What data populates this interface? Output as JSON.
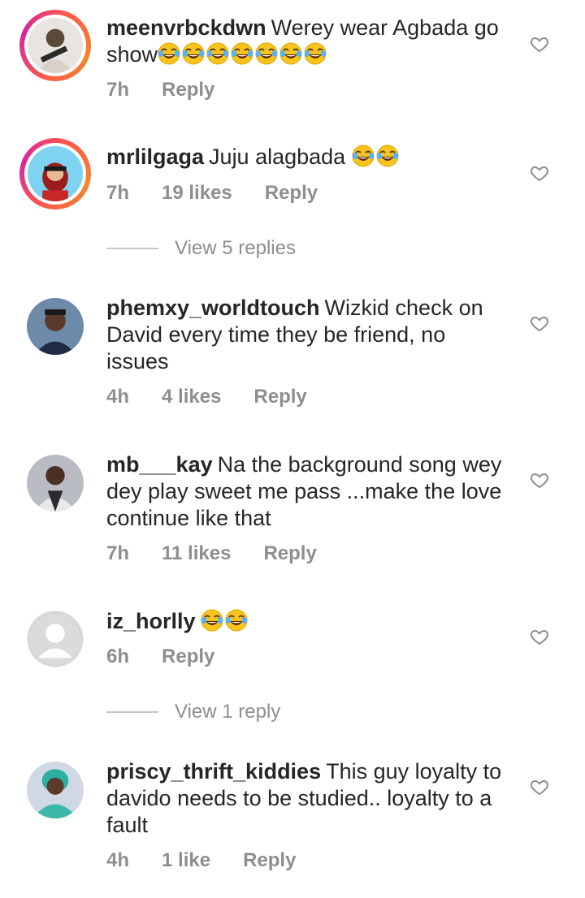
{
  "comments": [
    {
      "username": "meenvrbckdwn",
      "text": "Werey wear Agbada go show",
      "emoji_count": 7,
      "time": "7h",
      "likes": "",
      "reply": "Reply"
    },
    {
      "username": "mrlilgaga",
      "text": "Juju alagbada",
      "emoji_count": 2,
      "time": "7h",
      "likes": "19 likes",
      "reply": "Reply"
    },
    {
      "username": "phemxy_worldtouch",
      "text": "Wizkid check on David every time they be friend, no issues",
      "emoji_count": 0,
      "time": "4h",
      "likes": "4 likes",
      "reply": "Reply"
    },
    {
      "username": "mb___kay",
      "text": "Na the background song wey dey play sweet me pass ...make the love continue like that",
      "emoji_count": 0,
      "time": "7h",
      "likes": "11 likes",
      "reply": "Reply"
    },
    {
      "username": "iz_horlly",
      "text": "",
      "emoji_count": 2,
      "time": "6h",
      "likes": "",
      "reply": "Reply"
    },
    {
      "username": "priscy_thrift_kiddies",
      "text": "This guy loyalty to davido needs to be studied.. loyalty to a fault",
      "emoji_count": 0,
      "time": "4h",
      "likes": "1 like",
      "reply": "Reply"
    }
  ],
  "view_replies": [
    "View 5 replies",
    "View 1 reply"
  ],
  "icons": {
    "like": "heart-outline-icon",
    "emoji": "face-with-tears-of-joy-icon"
  },
  "colors": {
    "meta": "#8e8e8e",
    "text": "#262626",
    "story_ring": "#d6249f"
  }
}
